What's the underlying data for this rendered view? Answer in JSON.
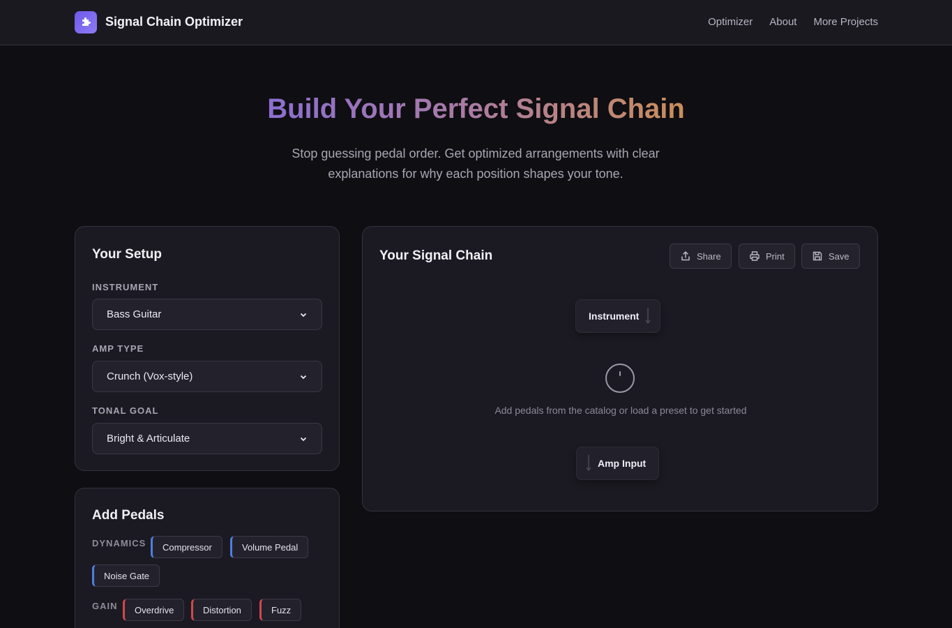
{
  "header": {
    "brand": "Signal Chain Optimizer",
    "nav": [
      "Optimizer",
      "About",
      "More Projects"
    ],
    "accent": "#7c66ec"
  },
  "hero": {
    "title": "Build Your Perfect Signal Chain",
    "subtitle": "Stop guessing pedal order. Get optimized arrangements with clear explanations for why each position shapes your tone."
  },
  "setup": {
    "title": "Your Setup",
    "instrument_label": "INSTRUMENT",
    "instrument_value": "Bass Guitar",
    "amp_label": "AMP TYPE",
    "amp_value": "Crunch (Vox-style)",
    "tone_label": "TONAL GOAL",
    "tone_value": "Bright & Articulate"
  },
  "pedals": {
    "title": "Add Pedals",
    "categories": [
      {
        "label": "DYNAMICS",
        "color": "#4d7fe0",
        "items": [
          "Compressor",
          "Volume Pedal",
          "Noise Gate"
        ]
      },
      {
        "label": "GAIN",
        "color": "#d2484d",
        "items": [
          "Overdrive",
          "Distortion",
          "Fuzz"
        ]
      }
    ]
  },
  "chain": {
    "title": "Your Signal Chain",
    "buttons": {
      "share": "Share",
      "print": "Print",
      "save": "Save"
    },
    "start_node": "Instrument",
    "end_node": "Amp Input",
    "empty_message": "Add pedals from the catalog or load a preset to get started"
  }
}
